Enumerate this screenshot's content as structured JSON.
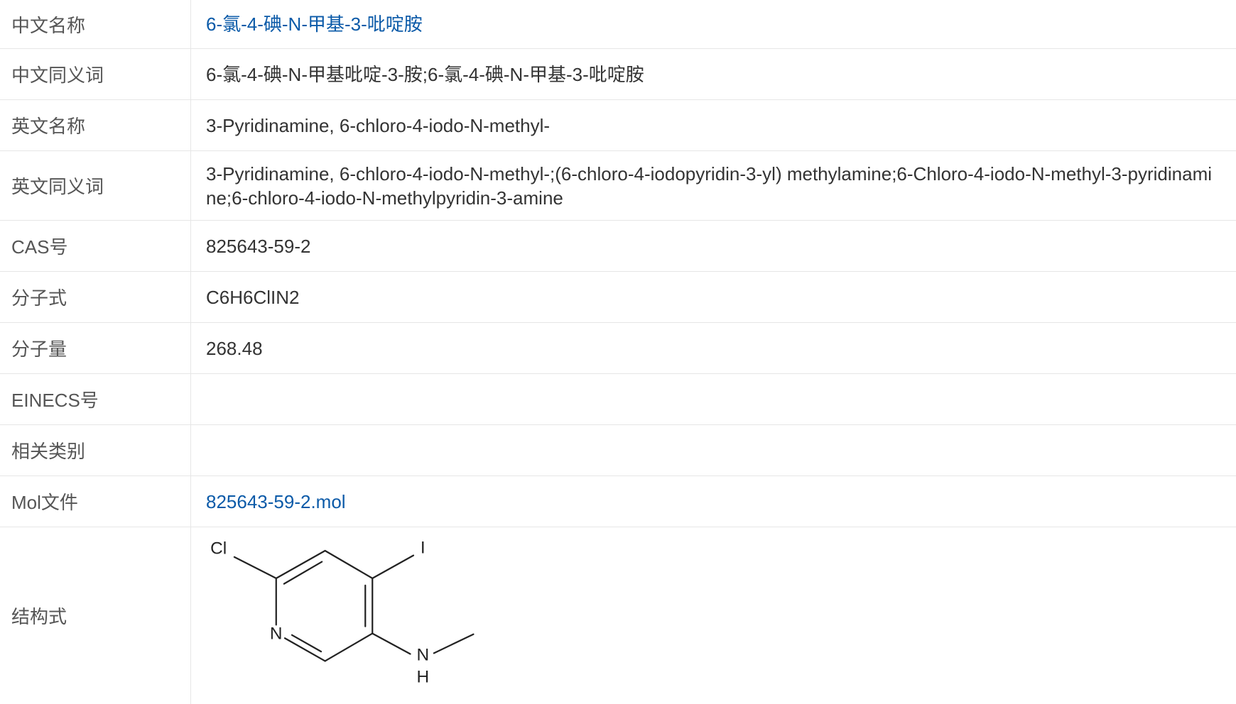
{
  "colors": {
    "label_text": "#555555",
    "value_text": "#333333",
    "link": "#0b5aa8",
    "border": "#e6e6e6",
    "bond": "#222222"
  },
  "rows": [
    {
      "label": "中文名称",
      "value": "6-氯-4-碘-N-甲基-3-吡啶胺"
    },
    {
      "label": "中文同义词",
      "value": "6-氯-4-碘-N-甲基吡啶-3-胺;6-氯-4-碘-N-甲基-3-吡啶胺"
    },
    {
      "label": "英文名称",
      "value": "3-Pyridinamine, 6-chloro-4-iodo-N-methyl-"
    },
    {
      "label": "英文同义词",
      "value": "3-Pyridinamine, 6-chloro-4-iodo-N-methyl-;(6-chloro-4-iodopyridin-3-yl) methylamine;6-Chloro-4-iodo-N-methyl-3-pyridinamine;6-chloro-4-iodo-N-methylpyridin-3-amine"
    },
    {
      "label": "CAS号",
      "value": "825643-59-2"
    },
    {
      "label": "分子式",
      "value": "C6H6ClIN2"
    },
    {
      "label": "分子量",
      "value": "268.48"
    },
    {
      "label": "EINECS号"
    },
    {
      "label": "相关类别"
    },
    {
      "label": "Mol文件",
      "value": "825643-59-2.mol"
    },
    {
      "label": "结构式"
    }
  ],
  "structure": {
    "atoms": {
      "cl": "Cl",
      "i": "I",
      "n_ring": "N",
      "n_amine": "N",
      "h_amine": "H"
    }
  }
}
